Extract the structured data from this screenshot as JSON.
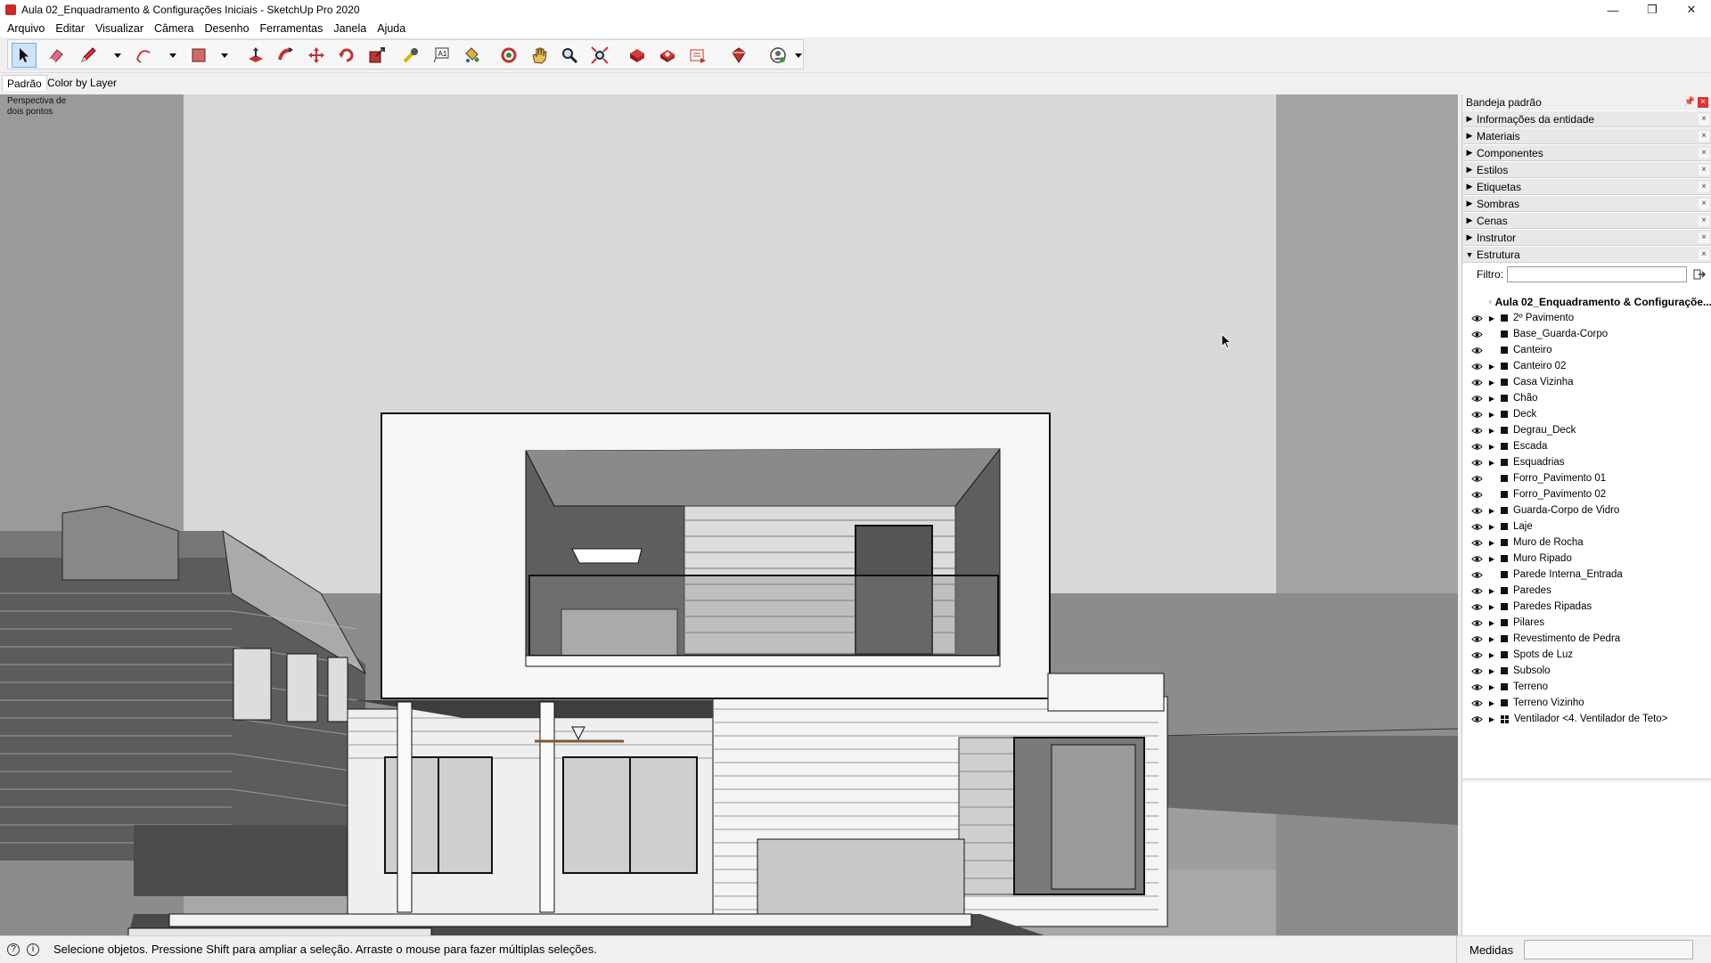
{
  "window": {
    "title": "Aula 02_Enquadramento & Configurações Iniciais - SketchUp Pro 2020",
    "controls": [
      "—",
      "❐",
      "✕"
    ]
  },
  "menu": [
    "Arquivo",
    "Editar",
    "Visualizar",
    "Câmera",
    "Desenho",
    "Ferramentas",
    "Janela",
    "Ajuda"
  ],
  "toolbar": {
    "tools": [
      "select-icon",
      "eraser-icon",
      "pencil-icon",
      "arc-icon",
      "rectangle-icon",
      "push-pull-icon",
      "follow-me-icon",
      "move-icon",
      "rotate-icon",
      "scale-icon",
      "tape-measure-icon",
      "text-icon",
      "paint-bucket-icon",
      "orbit-icon",
      "pan-icon",
      "zoom-icon",
      "zoom-extents-icon",
      "3d-warehouse-icon",
      "extension-warehouse-icon",
      "layout-icon",
      "extension-manager-icon",
      "account-icon"
    ],
    "accent": "#c8282a"
  },
  "scene_tabs": [
    "Padrão",
    "Color by Layer"
  ],
  "viewport": {
    "camera_label_1": "Perspectiva de",
    "camera_label_2": "dois pontos"
  },
  "tray": {
    "title": "Bandeja padrão",
    "panels": [
      "Informações da entidade",
      "Materiais",
      "Componentes",
      "Estilos",
      "Etiquetas",
      "Sombras",
      "Cenas",
      "Instrutor",
      "Estrutura"
    ],
    "filter_label": "Filtro:",
    "filter_value": "",
    "model_name": "Aula 02_Enquadramento & Configuraçõe...",
    "outliner": [
      {
        "name": "2º Pavimento",
        "expand": true
      },
      {
        "name": "Base_Guarda-Corpo",
        "expand": false
      },
      {
        "name": "Canteiro",
        "expand": false
      },
      {
        "name": "Canteiro 02",
        "expand": true
      },
      {
        "name": "Casa Vizinha",
        "expand": true
      },
      {
        "name": "Chão",
        "expand": true
      },
      {
        "name": "Deck",
        "expand": true
      },
      {
        "name": "Degrau_Deck",
        "expand": true
      },
      {
        "name": "Escada",
        "expand": true
      },
      {
        "name": "Esquadrias",
        "expand": true
      },
      {
        "name": "Forro_Pavimento 01",
        "expand": false
      },
      {
        "name": "Forro_Pavimento 02",
        "expand": false
      },
      {
        "name": "Guarda-Corpo de Vidro",
        "expand": true
      },
      {
        "name": "Laje",
        "expand": true
      },
      {
        "name": "Muro de Rocha",
        "expand": true
      },
      {
        "name": "Muro Ripado",
        "expand": true
      },
      {
        "name": "Parede Interna_Entrada",
        "expand": false
      },
      {
        "name": "Paredes",
        "expand": true
      },
      {
        "name": "Paredes Ripadas",
        "expand": true
      },
      {
        "name": "Pilares",
        "expand": true
      },
      {
        "name": "Revestimento de Pedra",
        "expand": true
      },
      {
        "name": "Spots de Luz",
        "expand": true
      },
      {
        "name": "Subsolo",
        "expand": true
      },
      {
        "name": "Terreno",
        "expand": true
      },
      {
        "name": "Terreno Vizinho",
        "expand": true
      },
      {
        "name": "Ventilador <4. Ventilador de Teto>",
        "expand": true,
        "component": true
      }
    ]
  },
  "status": {
    "message": "Selecione objetos. Pressione Shift para ampliar a seleção. Arraste o mouse para fazer múltiplas seleções.",
    "measures_label": "Medidas",
    "measures_value": ""
  }
}
